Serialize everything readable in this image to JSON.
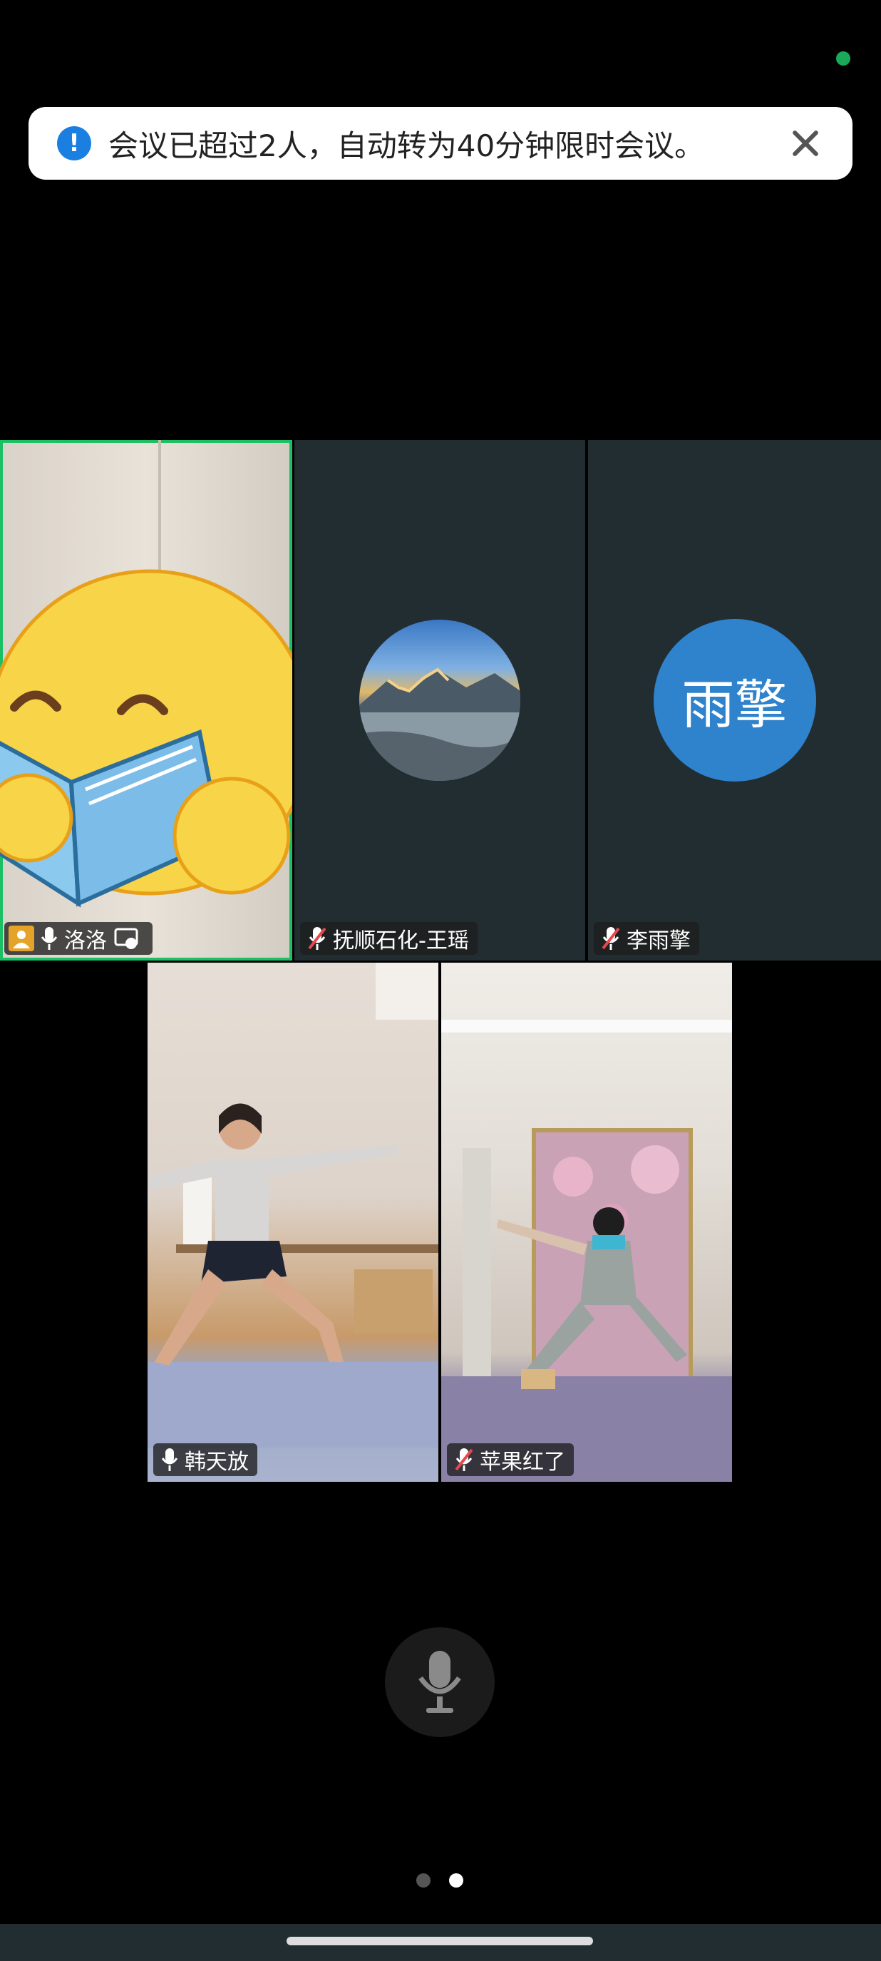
{
  "notice": {
    "message": "会议已超过2人，自动转为40分钟限时会议。",
    "info_icon": "info-icon",
    "close_icon": "close-icon"
  },
  "participants": [
    {
      "name": "洛洛",
      "mic": "on",
      "video": true,
      "active_speaker": true,
      "status_icons": [
        "person-icon",
        "mic-icon",
        "share-icon"
      ],
      "overlay": "emoji-reading-book"
    },
    {
      "name": "抚顺石化-王瑶",
      "mic": "muted",
      "video": false,
      "avatar": "photo"
    },
    {
      "name": "李雨擎",
      "mic": "muted",
      "video": false,
      "avatar_text": "雨擎"
    },
    {
      "name": "韩天放",
      "mic": "on",
      "video": true
    },
    {
      "name": "苹果红了",
      "mic": "muted",
      "video": true
    }
  ],
  "controls": {
    "mic_icon": "microphone-icon"
  },
  "pagination": {
    "total": 2,
    "current": 2
  },
  "colors": {
    "active_border": "#1bbf64",
    "avatar_blue": "#2f82cc",
    "tile_bg": "#222d31",
    "info_blue": "#1a7fe0"
  }
}
